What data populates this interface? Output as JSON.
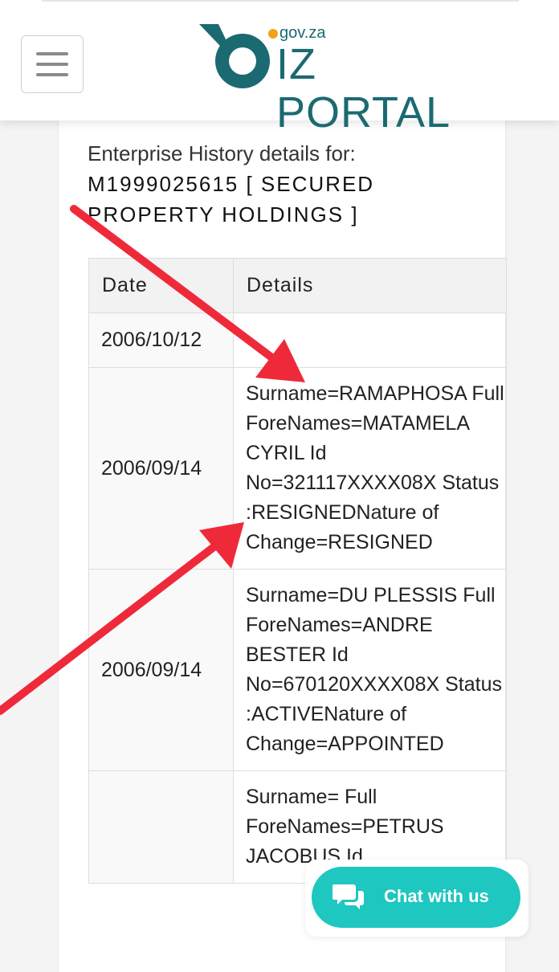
{
  "header": {
    "logo": {
      "domain_text": "gov.za",
      "brand_text": "IZ PORTAL",
      "colors": {
        "teal": "#1b6a71",
        "orange": "#f2a21a"
      }
    },
    "menu_icon": "hamburger-menu-icon"
  },
  "history": {
    "label": "Enterprise History details for:",
    "enterprise": "M1999025615 [ SECURED PROPERTY HOLDINGS ]"
  },
  "table": {
    "headers": {
      "date": "Date",
      "details": "Details"
    },
    "rows": [
      {
        "date": "2006/10/12",
        "details": ""
      },
      {
        "date": "2006/09/14",
        "details": "Surname=RAMAPHOSA Full ForeNames=MATAMELA CYRIL Id No=321117XXXX08X Status :RESIGNEDNature of Change=RESIGNED"
      },
      {
        "date": "2006/09/14",
        "details": "Surname=DU PLESSIS Full ForeNames=ANDRE BESTER Id No=670120XXXX08X Status :ACTIVENature of Change=APPOINTED"
      },
      {
        "date": "",
        "details": "Surname= Full ForeNames=PETRUS JACOBUS Id"
      }
    ]
  },
  "chat": {
    "label": "Chat with us",
    "icon": "chat-bubbles-icon",
    "color": "#1ec7c0"
  },
  "annotations": {
    "arrow_color": "#ee2a3a"
  }
}
